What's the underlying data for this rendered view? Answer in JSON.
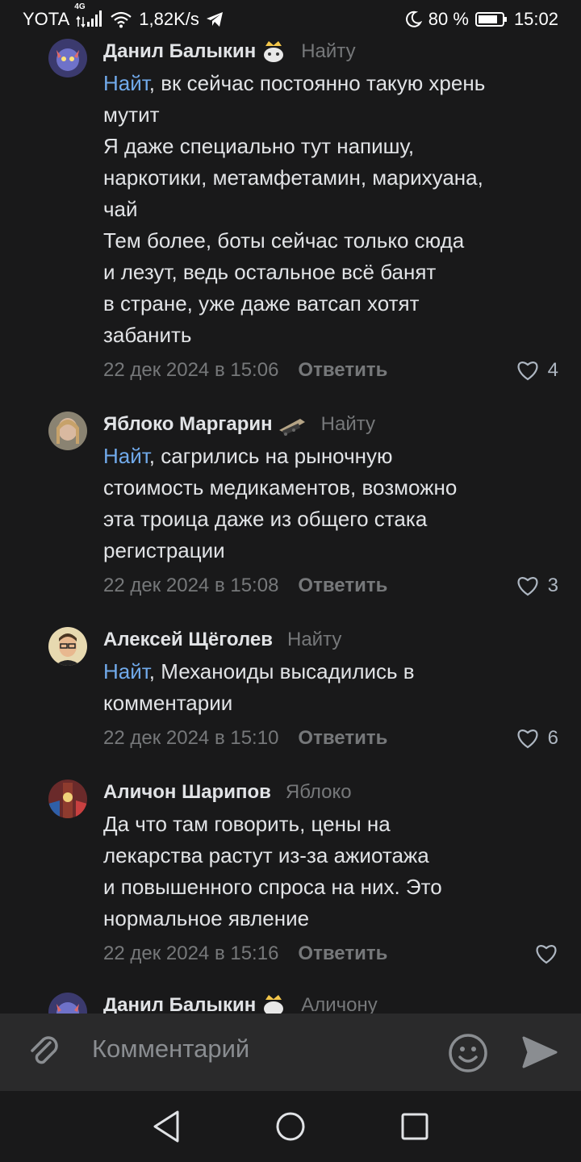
{
  "status_bar": {
    "carrier": "YOTA",
    "network": "4G",
    "speed": "1,82K/s",
    "battery": "80 %",
    "time": "15:02",
    "icons": [
      "signal-icon",
      "wifi-icon",
      "telegram-icon",
      "moon-icon",
      "battery-icon"
    ]
  },
  "comments": [
    {
      "author": "Данил Балыкин",
      "reply_to": "Найту",
      "mention": "Найт",
      "text": ", вк сейчас постоянно такую хрень\nмутит\nЯ даже специально тут напишу,\nнаркотики, метамфетамин, марихуана,\nчай\nТем более, боты сейчас только сюда\nи лезут, ведь остальное всё банят\nв стране, уже даже ватсап хотят\nзабанить",
      "date": "22 дек 2024 в 15:06",
      "reply_label": "Ответить",
      "likes": "4"
    },
    {
      "author": "Яблоко Маргарин",
      "reply_to": "Найту",
      "mention": "Найт",
      "text": ", сагрились на рыночную\nстоимость медикаментов, возможно\nэта троица даже из общего стака\nрегистрации",
      "date": "22 дек 2024 в 15:08",
      "reply_label": "Ответить",
      "likes": "3"
    },
    {
      "author": "Алексей Щёголев",
      "reply_to": "Найту",
      "mention": "Найт",
      "text": ", Механоиды высадились в\nкомментарии",
      "date": "22 дек 2024 в 15:10",
      "reply_label": "Ответить",
      "likes": "6"
    },
    {
      "author": "Аличон Шарипов",
      "reply_to": "Яблоко",
      "mention": "",
      "text": "Да что там говорить, цены на\nлекарства растут из-за ажиотажа\nи повышенного спроса на них. Это\nнормальное явление",
      "date": "22 дек 2024 в 15:16",
      "reply_label": "Ответить",
      "likes": ""
    },
    {
      "author": "Данил Балыкин",
      "reply_to": "Аличону",
      "mention": "",
      "text": "",
      "date": "",
      "reply_label": "",
      "likes": ""
    }
  ],
  "composer": {
    "placeholder": "Комментарий"
  },
  "colors": {
    "background": "#19191a",
    "link": "#71aaeb",
    "secondary": "#76787a"
  }
}
